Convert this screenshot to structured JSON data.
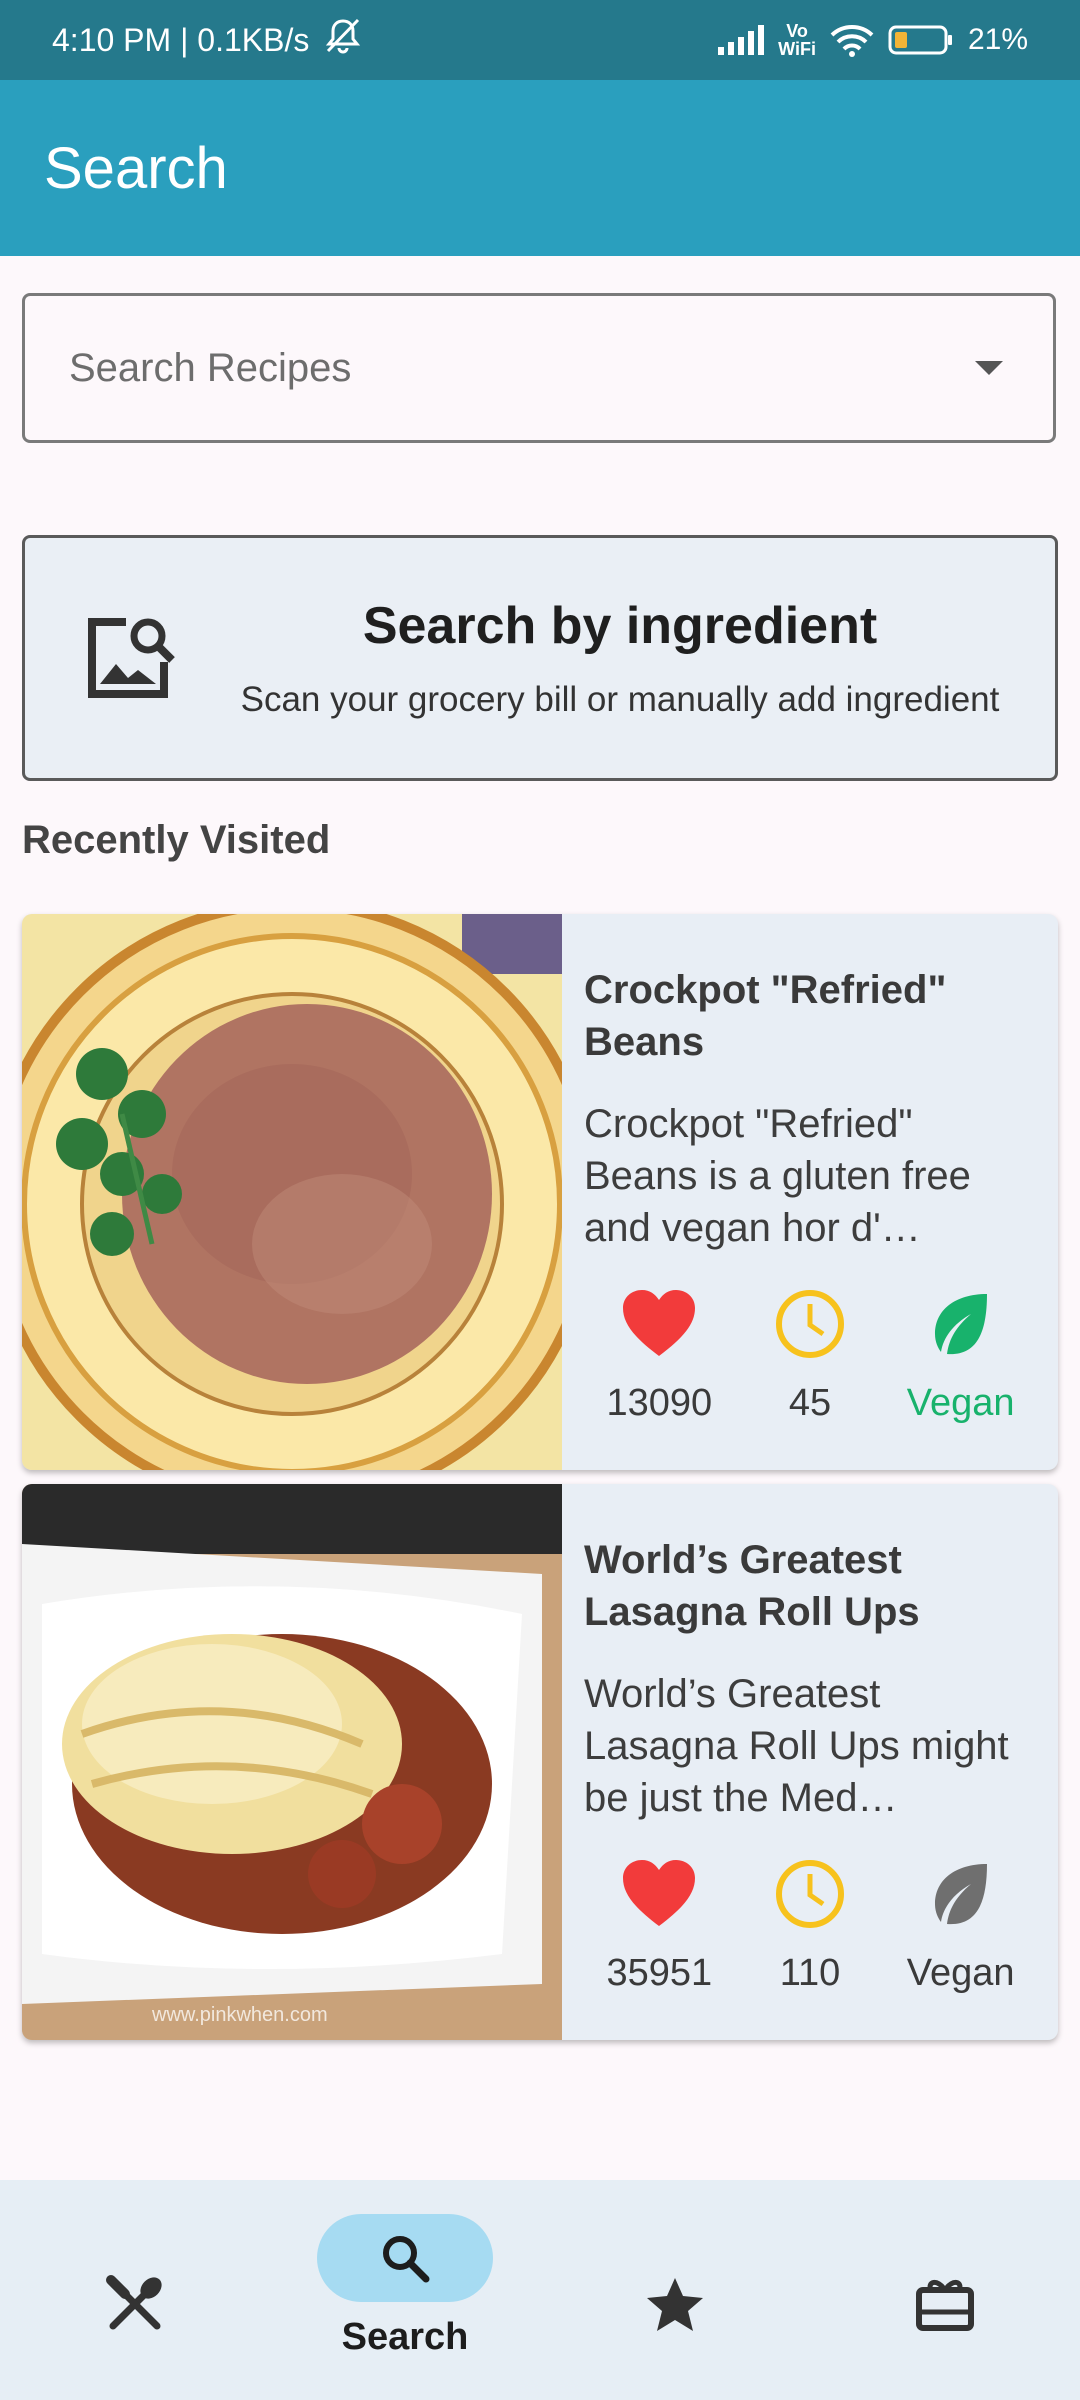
{
  "status_bar": {
    "time_speed": "4:10 PM | 0.1KB/s",
    "vowifi_top": "Vo",
    "vowifi_bottom": "WiFi",
    "battery": "21%"
  },
  "app_bar": {
    "title": "Search"
  },
  "search": {
    "placeholder": "Search Recipes",
    "value": ""
  },
  "ingredient_card": {
    "title": "Search by ingredient",
    "subtitle": "Scan your grocery bill or manually add ingredient",
    "icon": "image-search-icon"
  },
  "recent": {
    "heading": "Recently Visited",
    "items": [
      {
        "title": "Crockpot \"Refried\" Beans",
        "description": "Crockpot \"Refried\" Beans is a gluten free and vegan hor d'…",
        "likes": "13090",
        "minutes": "45",
        "diet": "Vegan",
        "vegan": true
      },
      {
        "title": "World’s Greatest Lasagna Roll Ups",
        "description": "World’s Greatest Lasagna Roll Ups might be just the Med…",
        "likes": "35951",
        "minutes": "110",
        "diet": "Vegan",
        "vegan": false,
        "image_watermark": "www.pinkwhen.com"
      }
    ]
  },
  "bottom_nav": {
    "items": [
      {
        "icon": "utensils-icon",
        "label": ""
      },
      {
        "icon": "search-icon",
        "label": "Search",
        "active": true
      },
      {
        "icon": "star-icon",
        "label": ""
      },
      {
        "icon": "gift-card-icon",
        "label": ""
      }
    ]
  },
  "colors": {
    "status_bar": "#25798c",
    "app_bar": "#2a9fbe",
    "heart": "#f23b3b",
    "clock": "#f7c21d",
    "vegan_green": "#18b26c",
    "active_pill": "#a6dbf2"
  }
}
